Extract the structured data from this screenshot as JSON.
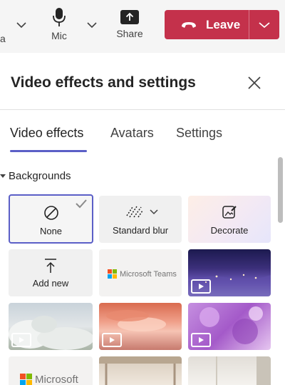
{
  "toolbar": {
    "cut_label": "a",
    "mic_label": "Mic",
    "share_label": "Share",
    "leave_label": "Leave"
  },
  "panel": {
    "title": "Video effects and settings",
    "tabs": [
      {
        "label": "Video effects",
        "active": true
      },
      {
        "label": "Avatars",
        "active": false
      },
      {
        "label": "Settings",
        "active": false
      }
    ],
    "section_label": "Backgrounds"
  },
  "backgrounds": {
    "none_label": "None",
    "blur_label": "Standard blur",
    "decorate_label": "Decorate",
    "add_new_label": "Add new",
    "teams_logo_text": "Microsoft Teams",
    "microsoft_logo_text": "Microsoft"
  },
  "colors": {
    "accent": "#5b5fc7",
    "leave_red": "#c4314b",
    "toolbar_bg": "#f5f5f5"
  }
}
